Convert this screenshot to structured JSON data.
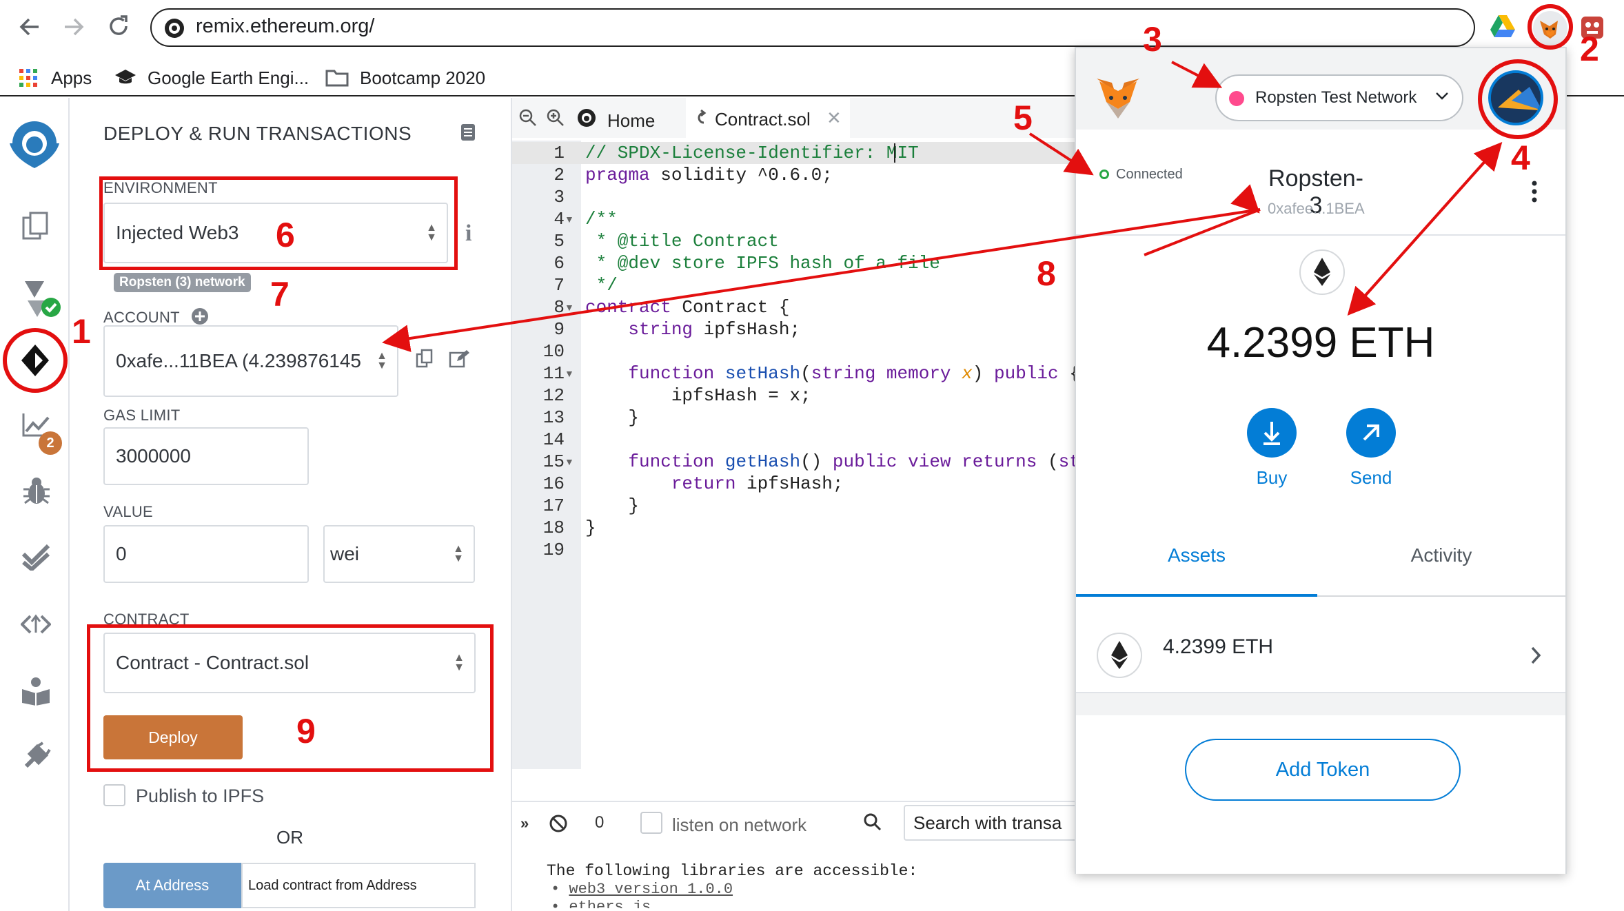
{
  "browser": {
    "url": "remix.ethereum.org/",
    "bookmarks": [
      "Apps",
      "Google Earth Engi...",
      "Bootcamp 2020"
    ]
  },
  "remix": {
    "panel_title": "DEPLOY & RUN TRANSACTIONS",
    "environment_label": "ENVIRONMENT",
    "environment_value": "Injected Web3",
    "network_badge": "Ropsten (3) network",
    "account_label": "ACCOUNT",
    "account_value": "0xafe...11BEA (4.239876145",
    "gas_limit_label": "GAS LIMIT",
    "gas_limit_value": "3000000",
    "value_label": "VALUE",
    "value_value": "0",
    "value_unit": "wei",
    "contract_label": "CONTRACT",
    "contract_value": "Contract - Contract.sol",
    "deploy_label": "Deploy",
    "publish_label": "Publish to IPFS",
    "or_label": "OR",
    "at_address_label": "At Address",
    "load_address_placeholder": "Load contract from Address",
    "rail_badge_count": "2",
    "tabs": {
      "home": "Home",
      "file": "Contract.sol"
    },
    "code_lines": [
      "// SPDX-License-Identifier: MIT",
      "pragma solidity ^0.6.0;",
      "",
      "/**",
      " * @title Contract",
      " * @dev store IPFS hash of a file",
      " */",
      "contract Contract {",
      "    string ipfsHash;",
      "",
      "    function setHash(string memory x) public {",
      "        ipfsHash = x;",
      "    }",
      "",
      "    function getHash() public view returns (string",
      "        return ipfsHash;",
      "    }",
      "}",
      ""
    ],
    "terminal": {
      "count": "0",
      "listen_label": "listen on network",
      "search_placeholder": "Search with transa",
      "intro": "The following libraries are accessible:",
      "lib1": "web3 version 1.0.0",
      "lib2": "ethers.js"
    }
  },
  "metamask": {
    "network": "Ropsten Test Network",
    "connected": "Connected",
    "account_name": "Ropsten-3",
    "account_address": "0xafee...1BEA",
    "balance": "4.2399 ETH",
    "buy_label": "Buy",
    "send_label": "Send",
    "tab_assets": "Assets",
    "tab_activity": "Activity",
    "asset_amount": "4.2399 ETH",
    "add_token_label": "Add Token"
  },
  "annotations": [
    "1",
    "2",
    "3",
    "4",
    "5",
    "6",
    "7",
    "8",
    "9"
  ],
  "colors": {
    "annotation_red": "#e30f0f",
    "deploy_orange": "#c97539",
    "at_address_blue": "#6b9ac8",
    "metamask_blue": "#037dd6",
    "remix_blue": "#2a7bbb"
  }
}
